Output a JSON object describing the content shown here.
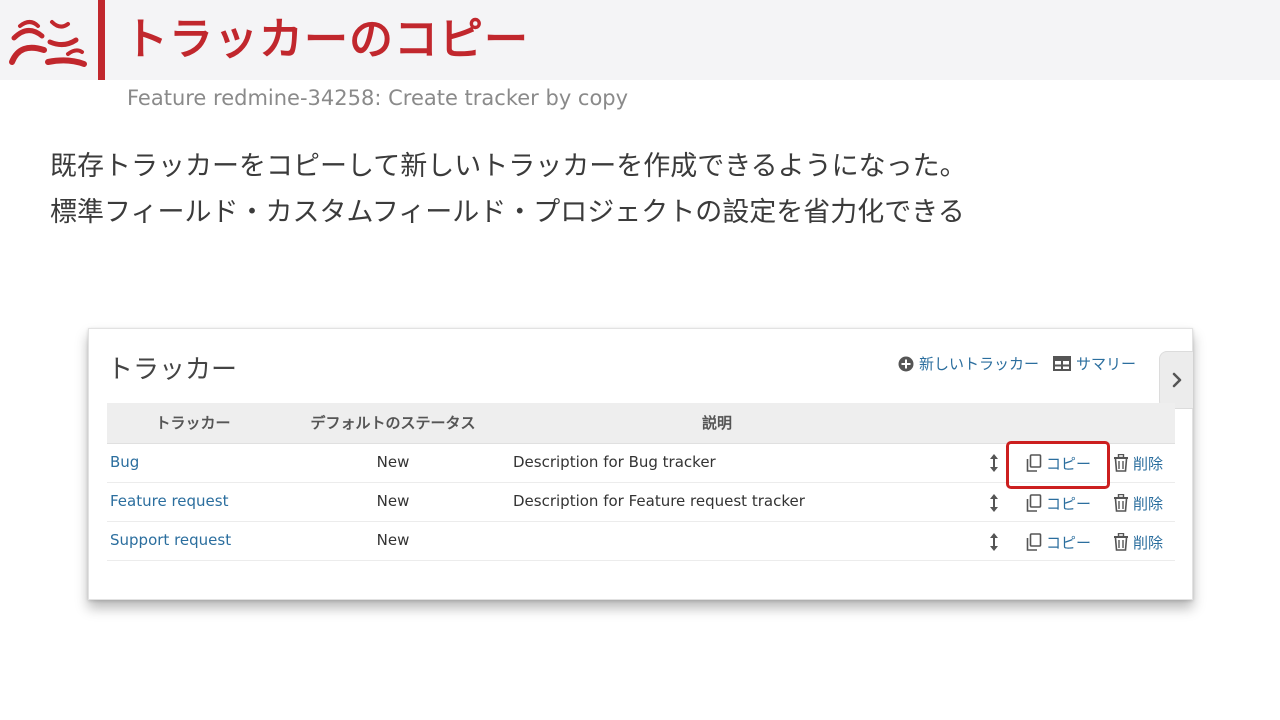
{
  "slide": {
    "title": "トラッカーのコピー",
    "subtitle": "Feature redmine-34258: Create tracker by copy",
    "description_lines": [
      "既存トラッカーをコピーして新しいトラッカーを作成できるようになった。",
      "標準フィールド・カスタムフィールド・プロジェクトの設定を省力化できる"
    ],
    "accent_color": "#c1272d"
  },
  "panel": {
    "title": "トラッカー",
    "actions": {
      "new_tracker": "新しいトラッカー",
      "summary": "サマリー"
    },
    "table": {
      "headers": [
        "トラッカー",
        "デフォルトのステータス",
        "説明",
        ""
      ],
      "rows": [
        {
          "name": "Bug",
          "default_status": "New",
          "description": "Description for Bug tracker",
          "copy": "コピー",
          "delete": "削除"
        },
        {
          "name": "Feature request",
          "default_status": "New",
          "description": "Description for Feature request tracker",
          "copy": "コピー",
          "delete": "削除"
        },
        {
          "name": "Support request",
          "default_status": "New",
          "description": "",
          "copy": "コピー",
          "delete": "削除"
        }
      ]
    },
    "link_color": "#2b6e9e",
    "highlight_color": "#cc1f1f"
  }
}
